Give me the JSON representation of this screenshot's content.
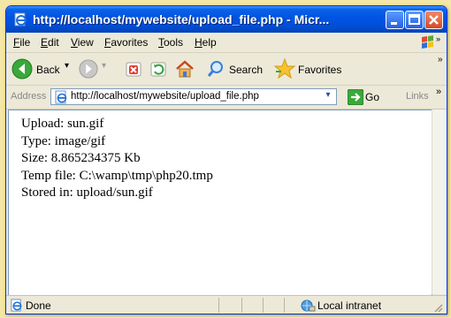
{
  "window": {
    "title": "http://localhost/mywebsite/upload_file.php - Micr..."
  },
  "menu": [
    "File",
    "Edit",
    "View",
    "Favorites",
    "Tools",
    "Help"
  ],
  "toolbar": {
    "back_label": "Back",
    "search_label": "Search",
    "favorites_label": "Favorites"
  },
  "address": {
    "label": "Address",
    "url": "http://localhost/mywebsite/upload_file.php",
    "go_label": "Go",
    "links_label": "Links"
  },
  "content": {
    "lines": [
      "Upload: sun.gif",
      "Type: image/gif",
      "Size: 8.865234375 Kb",
      "Temp file: C:\\wamp\\tmp\\php20.tmp",
      "Stored in: upload/sun.gif"
    ]
  },
  "status": {
    "text": "Done",
    "zone": "Local intranet"
  },
  "colors": {
    "titlebar": "#0054e3",
    "chrome": "#ece9d8",
    "background": "#f4e6a6"
  }
}
